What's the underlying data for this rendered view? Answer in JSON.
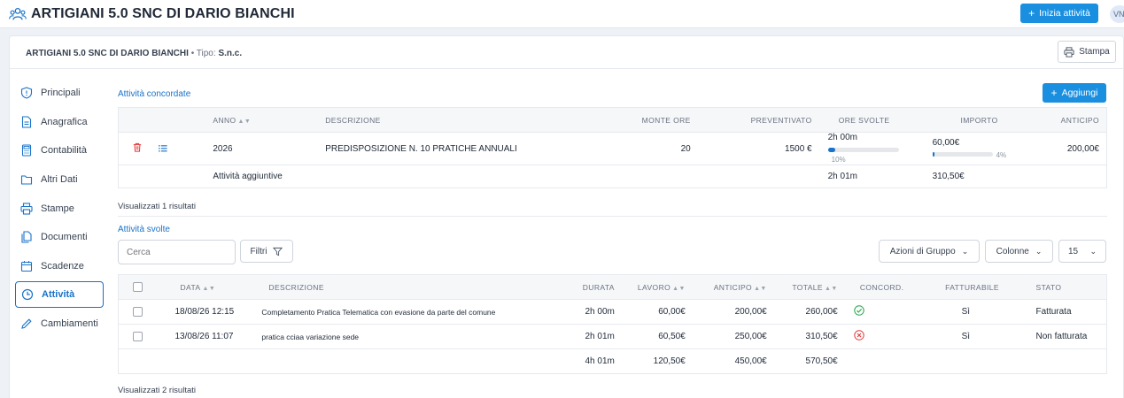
{
  "topbar": {
    "title": "ARTIGIANI 5.0 SNC DI DARIO BIANCHI",
    "start_button": "Inizia attività",
    "avatar_initials": "VN"
  },
  "header": {
    "company": "ARTIGIANI 5.0 SNC DI DARIO BIANCHI",
    "type_label": "• Tipo:",
    "type_value": "S.n.c.",
    "print_button": "Stampa"
  },
  "sidebar": {
    "items": [
      {
        "label": "Principali",
        "icon": "shield-icon"
      },
      {
        "label": "Anagrafica",
        "icon": "document-icon"
      },
      {
        "label": "Contabilità",
        "icon": "calculator-icon"
      },
      {
        "label": "Altri Dati",
        "icon": "folder-icon"
      },
      {
        "label": "Stampe",
        "icon": "printer-icon"
      },
      {
        "label": "Documenti",
        "icon": "documents-icon"
      },
      {
        "label": "Scadenze",
        "icon": "calendar-icon"
      },
      {
        "label": "Attività",
        "icon": "clock-icon",
        "active": true
      },
      {
        "label": "Cambiamenti",
        "icon": "pencil-icon"
      }
    ]
  },
  "concordate": {
    "title": "Attività concordate",
    "add_button": "Aggiungi",
    "headers": [
      "ANNO",
      "DESCRIZIONE",
      "MONTE ORE",
      "PREVENTIVATO",
      "ORE SVOLTE",
      "IMPORTO",
      "ANTICIPO"
    ],
    "row": {
      "anno": "2026",
      "descrizione": "PREDISPOSIZIONE N. 10 PRATICHE ANNUALI",
      "monte_ore": "20",
      "preventivato": "1500 €",
      "ore_svolte": "2h 00m",
      "ore_pct_label": "10%",
      "ore_pct": 10,
      "importo": "60,00€",
      "importo_pct_label": "4%",
      "importo_pct": 4,
      "anticipo": "200,00€"
    },
    "extra_row": {
      "label": "Attività aggiuntive",
      "ore_svolte": "2h 01m",
      "importo": "310,50€"
    },
    "results": "Visualizzati 1 risultati"
  },
  "svolte": {
    "title": "Attività svolte",
    "search_placeholder": "Cerca",
    "filters_button": "Filtri",
    "group_actions": "Azioni di Gruppo",
    "columns_button": "Colonne",
    "page_size": "15",
    "headers": [
      "DATA",
      "DESCRIZIONE",
      "DURATA",
      "LAVORO",
      "ANTICIPO",
      "TOTALE",
      "CONCORD.",
      "FATTURABILE",
      "STATO"
    ],
    "rows": [
      {
        "data": "18/08/26 12:15",
        "descrizione": "Completamento Pratica Telematica con evasione da parte del comune",
        "durata": "2h 00m",
        "lavoro": "60,00€",
        "anticipo": "200,00€",
        "totale": "260,00€",
        "concord": "check",
        "fatturabile": "Sì",
        "stato": "Fatturata"
      },
      {
        "data": "13/08/26 11:07",
        "descrizione": "pratica cciaa variazione sede",
        "durata": "2h 01m",
        "lavoro": "60,50€",
        "anticipo": "250,00€",
        "totale": "310,50€",
        "concord": "cross",
        "fatturabile": "Sì",
        "stato": "Non fatturata"
      }
    ],
    "totals": {
      "durata": "4h 01m",
      "lavoro": "120,50€",
      "anticipo": "450,00€",
      "totale": "570,50€"
    },
    "results": "Visualizzati 2 risultati"
  },
  "colors": {
    "accent": "#1a8fe0",
    "link": "#1a73c8",
    "ok": "#22a34a",
    "danger": "#e23b3b"
  }
}
